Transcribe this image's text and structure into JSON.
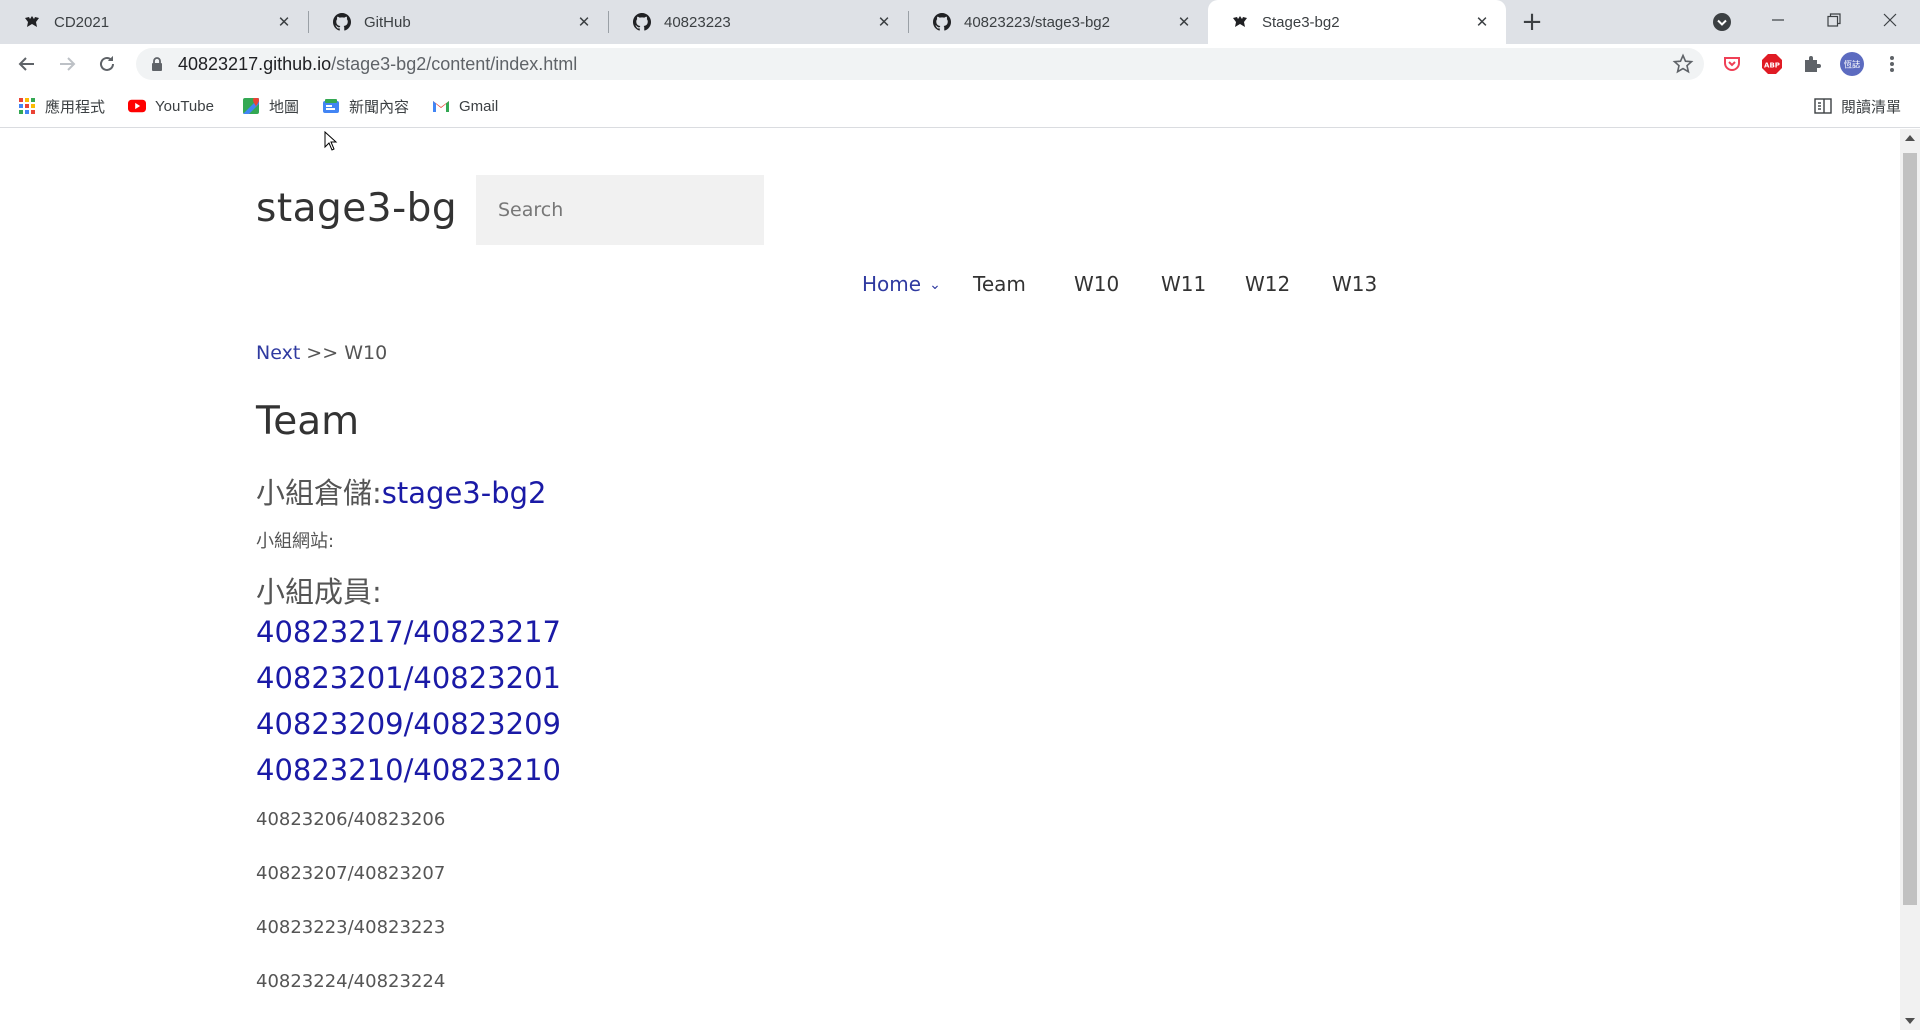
{
  "tabs": [
    {
      "title": "CD2021",
      "favicon": "bat-icon",
      "active": false
    },
    {
      "title": "GitHub",
      "favicon": "github-icon",
      "active": false
    },
    {
      "title": "40823223",
      "favicon": "github-icon",
      "active": false
    },
    {
      "title": "40823223/stage3-bg2",
      "favicon": "github-icon",
      "active": false
    },
    {
      "title": "Stage3-bg2",
      "favicon": "bat-icon",
      "active": true
    }
  ],
  "address": {
    "host": "40823217.github.io",
    "path": "/stage3-bg2/content/index.html"
  },
  "profile_label": "恆誌",
  "abp_label": "ABP",
  "bookmarks": {
    "apps": "應用程式",
    "youtube": "YouTube",
    "maps": "地圖",
    "news": "新聞內容",
    "gmail": "Gmail",
    "reading_list": "閱讀清單"
  },
  "page": {
    "site_title": "stage3-bg",
    "search_placeholder": "Search",
    "menu": [
      "Home",
      "Team",
      "W10",
      "W11",
      "W12",
      "W13"
    ],
    "breadcrumb": {
      "next": "Next",
      "sep": " >> ",
      "target": "W10"
    },
    "heading": "Team",
    "repo_label": "小組倉儲:",
    "repo_link": "stage3-bg2",
    "site_label": "小組網站:",
    "members_label": "小組成員:",
    "linked_members": [
      "40823217/40823217",
      "40823201/40823201",
      "40823209/40823209",
      "40823210/40823210"
    ],
    "plain_members": [
      "40823206/40823206",
      "40823207/40823207",
      "40823223/40823223",
      "40823224/40823224"
    ]
  },
  "colors": {
    "accent_link": "#1a1aa6",
    "menu_active": "#2f3aa0",
    "tabstrip_bg": "#dee1e6"
  }
}
